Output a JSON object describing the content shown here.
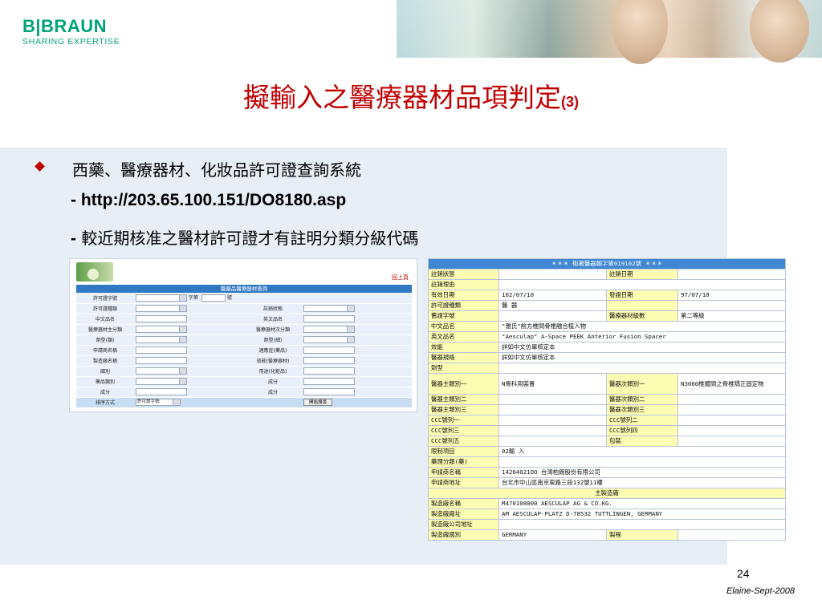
{
  "logo": {
    "brand": "B|BRAUN",
    "tagline": "SHARING EXPERTISE"
  },
  "title": {
    "main": "擬輸入之醫療器材品項判定",
    "suffix": "(3)"
  },
  "content": {
    "bullet": "西藥、醫療器材、化妝品許可證查詢系統",
    "url_line": "- http://203.65.100.151/DO8180.asp",
    "note_dash": "-",
    "note_text": "較近期核准之醫材許可證才有註明分類分級代碼"
  },
  "form": {
    "header": "醫藥品醫療器材查詢",
    "top_right": "回上頁",
    "rows": [
      {
        "left_label": "許可證字號",
        "left_extra": "字第",
        "left_unit": "號",
        "right_label": "",
        "left_type": "select-input",
        "right_type": "none"
      },
      {
        "left_label": "許可證種類",
        "right_label": "註銷狀態",
        "left_type": "select",
        "right_type": "select"
      },
      {
        "left_label": "中文品名",
        "right_label": "英文品名",
        "left_type": "input",
        "right_type": "input"
      },
      {
        "left_label": "醫療器材主分類",
        "right_label": "醫療器材次分類",
        "left_type": "select",
        "right_type": "select"
      },
      {
        "left_label": "劑型(類)",
        "right_label": "劑型(細)",
        "left_type": "select",
        "right_type": "select"
      },
      {
        "left_label": "申請商名稱",
        "right_label": "適應症(藥品)",
        "left_type": "input",
        "right_type": "input"
      },
      {
        "left_label": "製造廠名稱",
        "right_label": "效能(醫療器材)",
        "left_type": "input",
        "right_type": "input"
      },
      {
        "left_label": "國別",
        "right_label": "用途(化粧品)",
        "left_type": "select",
        "right_type": "input"
      },
      {
        "left_label": "藥品類別",
        "right_label": "成分",
        "left_type": "select",
        "right_type": "input"
      },
      {
        "left_label": "成分",
        "right_label": "成分",
        "left_type": "input",
        "right_type": "input"
      }
    ],
    "sort_label": "排序方式",
    "sort_value": "許可證字號",
    "search_button": "開始搜尋"
  },
  "detail": {
    "header": "＊＊＊ 衛署醫器輸字第019102號 ＊＊＊",
    "rows": [
      {
        "cells": [
          {
            "t": "註銷狀態",
            "c": "y"
          },
          {
            "t": ""
          },
          {
            "t": "註銷日期",
            "c": "y"
          },
          {
            "t": ""
          }
        ]
      },
      {
        "cells": [
          {
            "t": "註銷理由",
            "c": "y"
          },
          {
            "t": "",
            "span": 3
          }
        ]
      },
      {
        "cells": [
          {
            "t": "有效日期",
            "c": "y"
          },
          {
            "t": "102/07/10"
          },
          {
            "t": "發證日期",
            "c": "y"
          },
          {
            "t": "97/07/10"
          }
        ]
      },
      {
        "cells": [
          {
            "t": "許可證種類",
            "c": "y"
          },
          {
            "t": "醫  器"
          },
          {
            "t": "",
            "c": "y"
          },
          {
            "t": ""
          }
        ]
      },
      {
        "cells": [
          {
            "t": "舊證字號",
            "c": "y"
          },
          {
            "t": ""
          },
          {
            "t": "醫療器材級數",
            "c": "y"
          },
          {
            "t": "第二等級"
          }
        ]
      },
      {
        "cells": [
          {
            "t": "中文品名",
            "c": "y"
          },
          {
            "t": "\"雅氏\"前方椎間骨椎融合植入物",
            "span": 3
          }
        ]
      },
      {
        "cells": [
          {
            "t": "英文品名",
            "c": "y"
          },
          {
            "t": "\"Aesculap\" A-Space PEEK Anterior Fusion Spacer",
            "span": 3
          }
        ]
      },
      {
        "cells": [
          {
            "t": "效能",
            "c": "y"
          },
          {
            "t": "詳如中文仿單核定本",
            "span": 3
          }
        ]
      },
      {
        "cells": [
          {
            "t": "醫器規格",
            "c": "y"
          },
          {
            "t": "詳如中文仿單核定本",
            "span": 3
          }
        ]
      },
      {
        "cells": [
          {
            "t": "劑型",
            "c": "y"
          },
          {
            "t": "",
            "span": 3
          }
        ]
      },
      {
        "tall": true,
        "cells": [
          {
            "t": "醫器主類別一",
            "c": "y"
          },
          {
            "t": "N骨科用裝置"
          },
          {
            "t": "醫器次類別一",
            "c": "y"
          },
          {
            "t": "N3060椎體間之骨椎矯正固定物",
            "wrap": true
          }
        ]
      },
      {
        "cells": [
          {
            "t": "醫器主類別二",
            "c": "y"
          },
          {
            "t": ""
          },
          {
            "t": "醫器次類別二",
            "c": "y"
          },
          {
            "t": ""
          }
        ]
      },
      {
        "cells": [
          {
            "t": "醫器主類別三",
            "c": "y"
          },
          {
            "t": ""
          },
          {
            "t": "醫器次類別三",
            "c": "y"
          },
          {
            "t": ""
          }
        ]
      },
      {
        "cells": [
          {
            "t": "CCC號列一",
            "c": "y"
          },
          {
            "t": ""
          },
          {
            "t": "CCC號列二",
            "c": "y"
          },
          {
            "t": ""
          }
        ]
      },
      {
        "cells": [
          {
            "t": "CCC號列三",
            "c": "y"
          },
          {
            "t": ""
          },
          {
            "t": "CCC號列四",
            "c": "y"
          },
          {
            "t": ""
          }
        ]
      },
      {
        "cells": [
          {
            "t": "CCC號列五",
            "c": "y"
          },
          {
            "t": ""
          },
          {
            "t": "包裝",
            "c": "y"
          },
          {
            "t": ""
          }
        ]
      },
      {
        "cells": [
          {
            "t": "限制項目",
            "c": "y"
          },
          {
            "t": "02輸  入",
            "span": 3
          }
        ]
      },
      {
        "cells": [
          {
            "t": "藥理分類(藥)",
            "c": "y"
          },
          {
            "t": "",
            "span": 3
          }
        ]
      },
      {
        "cells": [
          {
            "t": "申請商名稱",
            "c": "y"
          },
          {
            "t": "14264021OO 台灣柏朗股份有限公司",
            "span": 3
          }
        ]
      },
      {
        "cells": [
          {
            "t": "申請商地址",
            "c": "y"
          },
          {
            "t": "台北市中山區南京東路三段132號11樓",
            "span": 3
          }
        ]
      },
      {
        "cells": [
          {
            "t": "主製造廠",
            "c": "sec",
            "span": 4
          }
        ]
      },
      {
        "cells": [
          {
            "t": "製造廠名稱",
            "c": "y"
          },
          {
            "t": "M470108000 AESCULAP AG & CO.KG.",
            "span": 3
          }
        ]
      },
      {
        "cells": [
          {
            "t": "製造廠廠址",
            "c": "y"
          },
          {
            "t": "AM AESCULAP-PLATZ D-78532 TUTTLINGEN, GERMANY",
            "span": 3
          }
        ]
      },
      {
        "cells": [
          {
            "t": "製造廠公司地址",
            "c": "y"
          },
          {
            "t": "",
            "span": 3
          }
        ]
      },
      {
        "cells": [
          {
            "t": "製造廠國別",
            "c": "y"
          },
          {
            "t": "GERMANY"
          },
          {
            "t": "製程",
            "c": "y"
          },
          {
            "t": ""
          }
        ]
      }
    ]
  },
  "footer": {
    "page": "24",
    "author": "Elaine-Sept-2008"
  }
}
